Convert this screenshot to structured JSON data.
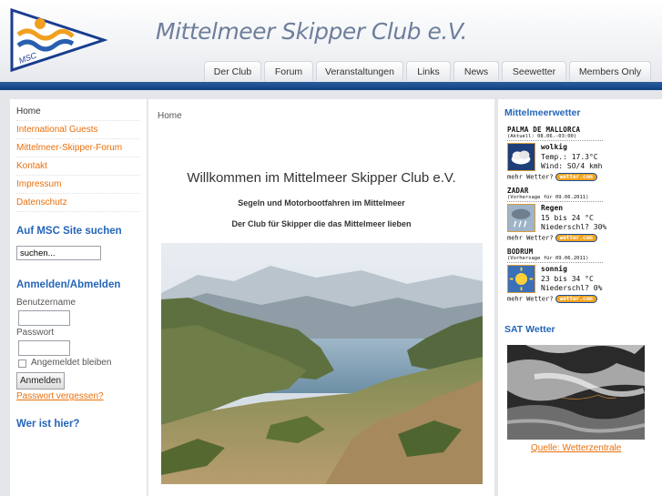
{
  "header": {
    "site_title": "Mittelmeer Skipper Club e.V.",
    "logo_text": "MSC",
    "nav": [
      "Der Club",
      "Forum",
      "Veranstaltungen",
      "Links",
      "News",
      "Seewetter",
      "Members Only"
    ]
  },
  "sidebar": {
    "menu": [
      "Home",
      "International Guests",
      "Mittelmeer-Skipper-Forum",
      "Kontakt",
      "Impressum",
      "Datenschutz"
    ],
    "search": {
      "heading": "Auf MSC Site suchen",
      "placeholder": "suchen..."
    },
    "login": {
      "heading": "Anmelden/Abmelden",
      "username_label": "Benutzername",
      "password_label": "Passwort",
      "remember_label": "Angemeldet bleiben",
      "button_label": "Anmelden",
      "forgot_label": "Passwort vergessen?"
    },
    "who_heading": "Wer ist hier?"
  },
  "main": {
    "breadcrumb": "Home",
    "title": "Willkommen im Mittelmeer Skipper Club e.V.",
    "subtitle1": "Segeln und Motorbootfahren im Mittelmeer",
    "subtitle2": "Der Club für Skipper die das Mittelmeer lieben"
  },
  "rightbar": {
    "weather_heading": "Mittelmeerwetter",
    "weather": [
      {
        "place": "PALMA DE MALLORCA",
        "note": "(Aktuell: 08.06.-03:00)",
        "icon": "cloudy-night-icon",
        "condition": "wolkig",
        "line1": "Temp.: 17.3°C",
        "line2": "Wind: SO/4 kmh",
        "more": "mehr Wetter?",
        "badge": "wetter.com"
      },
      {
        "place": "ZADAR",
        "note": "(Vorhersage für 09.06.2011)",
        "icon": "rain-icon",
        "condition": "Regen",
        "line1": "15 bis 24 °C",
        "line2": "Niederschl? 30%",
        "more": "mehr Wetter?",
        "badge": "wetter.com"
      },
      {
        "place": "BODRUM",
        "note": "(Vorhersage für 09.06.2011)",
        "icon": "sun-icon",
        "condition": "sonnig",
        "line1": "23 bis 34 °C",
        "line2": "Niederschl? 0%",
        "more": "mehr Wetter?",
        "badge": "wetter.com"
      }
    ],
    "sat_heading": "SAT Wetter",
    "sat_source": "Quelle: Wetterzentrale"
  },
  "colors": {
    "accent_blue": "#2565b8",
    "link_orange": "#e8700c",
    "header_bar": "#0c3f7e"
  }
}
